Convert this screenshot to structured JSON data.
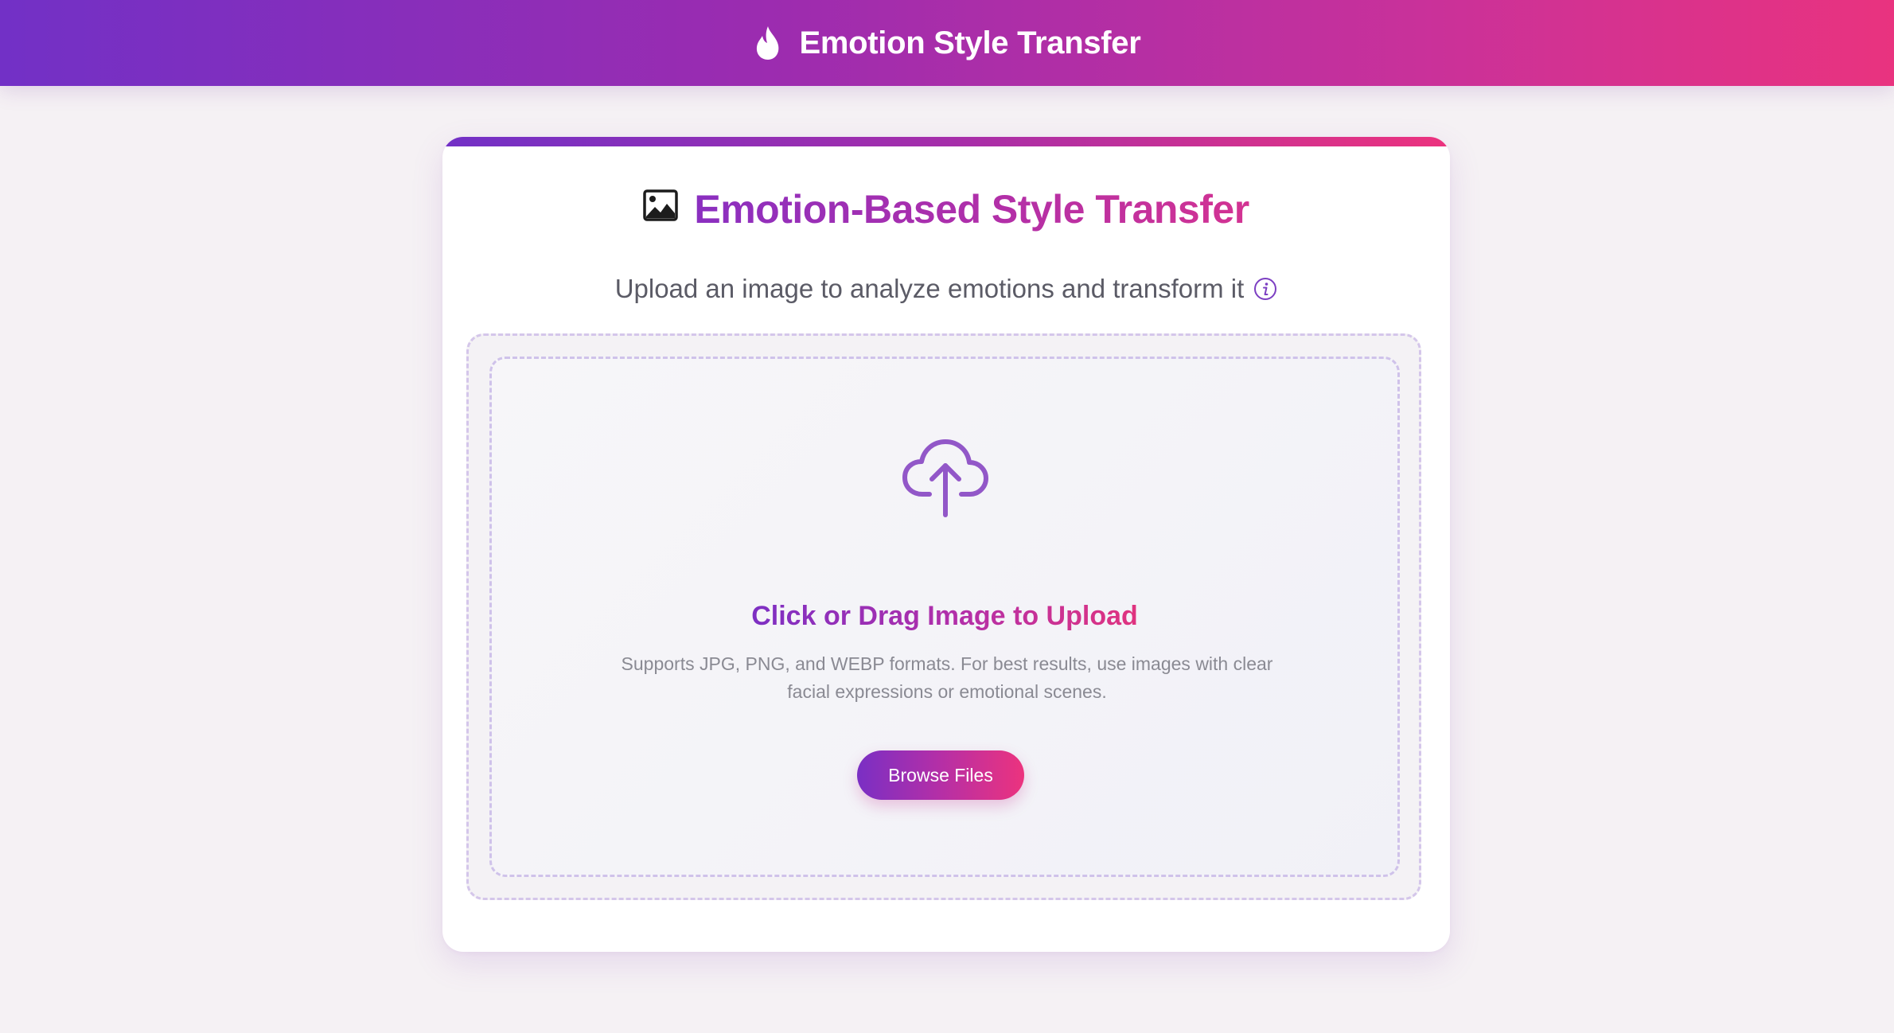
{
  "header": {
    "title": "Emotion Style Transfer",
    "icon": "flame-icon"
  },
  "card": {
    "heading": "Emotion-Based Style Transfer",
    "heading_icon": "picture-icon",
    "subtitle": "Upload an image to analyze emotions and transform it",
    "subtitle_icon": "info-icon"
  },
  "upload": {
    "icon": "cloud-upload-icon",
    "title": "Click or Drag Image to Upload",
    "description": "Supports JPG, PNG, and WEBP formats. For best results, use images with clear facial expressions or emotional scenes.",
    "button_label": "Browse Files"
  },
  "colors": {
    "gradient_start": "#7230c6",
    "gradient_end": "#e9337f",
    "accent_purple": "#9257c8",
    "page_background": "#f5f1f4"
  }
}
